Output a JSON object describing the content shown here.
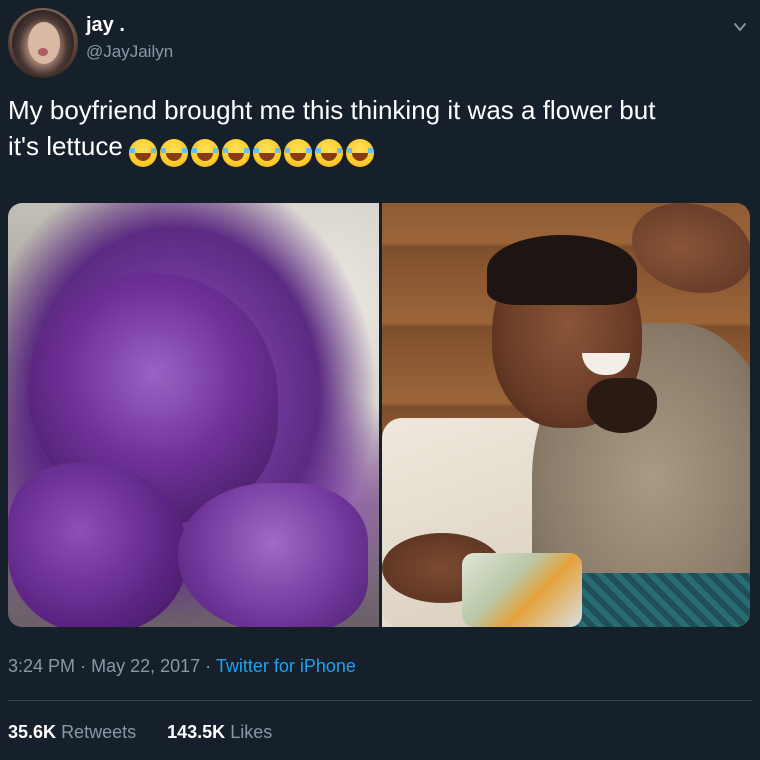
{
  "user": {
    "display_name": "jay .",
    "handle": "@JayJailyn"
  },
  "tweet": {
    "text_line1": "My boyfriend brought me this thinking it was a flower but",
    "text_line2": "it's lettuce",
    "emoji_name": "face-with-tears-of-joy-icon",
    "emoji_count": 8
  },
  "media": {
    "count": 2
  },
  "meta": {
    "time": "3:24 PM",
    "separator": "·",
    "date": "May 22, 2017",
    "source": "Twitter for iPhone"
  },
  "stats": {
    "retweets_count": "35.6K",
    "retweets_label": "Retweets",
    "likes_count": "143.5K",
    "likes_label": "Likes"
  },
  "colors": {
    "background": "#15202b",
    "text_primary": "#ffffff",
    "text_secondary": "#8899a6",
    "link": "#1da1f2",
    "divider": "#38444d"
  }
}
